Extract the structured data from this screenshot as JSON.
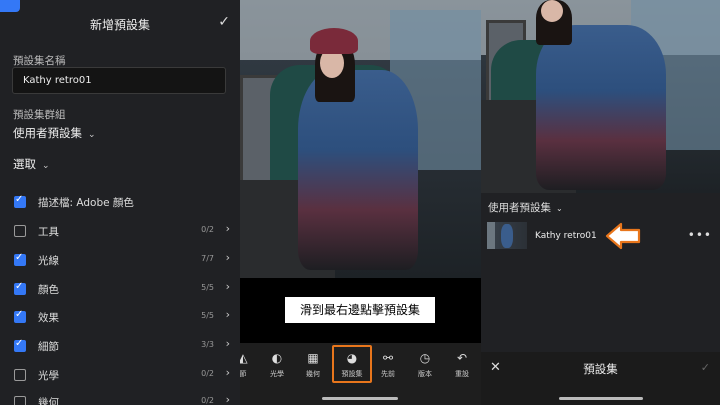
{
  "left": {
    "title": "新增預設集",
    "confirm_icon": "✓",
    "name_label": "預設集名稱",
    "name_value": "Kathy retro01",
    "group_label": "預設集群組",
    "group_value": "使用者預設集",
    "select_label": "選取",
    "chevron": "⌄",
    "items": [
      {
        "label": "描述檔: Adobe 顏色",
        "checked": true,
        "count": "",
        "arrow": ""
      },
      {
        "label": "工具",
        "checked": false,
        "count": "0/2",
        "arrow": "›"
      },
      {
        "label": "光線",
        "checked": true,
        "count": "7/7",
        "arrow": "›"
      },
      {
        "label": "顏色",
        "checked": true,
        "count": "5/5",
        "arrow": "›"
      },
      {
        "label": "效果",
        "checked": true,
        "count": "5/5",
        "arrow": "›"
      },
      {
        "label": "細節",
        "checked": true,
        "count": "3/3",
        "arrow": "›"
      },
      {
        "label": "光學",
        "checked": false,
        "count": "0/2",
        "arrow": "›"
      },
      {
        "label": "幾何",
        "checked": false,
        "count": "0/2",
        "arrow": "›"
      }
    ]
  },
  "middle": {
    "caption": "滑到最右邊點擊預設集",
    "tools": [
      {
        "label": "節",
        "icon": "◭"
      },
      {
        "label": "光學",
        "icon": "◐"
      },
      {
        "label": "幾何",
        "icon": "▦"
      },
      {
        "label": "預設集",
        "icon": "◕"
      },
      {
        "label": "先前",
        "icon": "⚯"
      },
      {
        "label": "版本",
        "icon": "◷"
      },
      {
        "label": "重設",
        "icon": "↶"
      }
    ]
  },
  "right": {
    "group_value": "使用者預設集",
    "chevron": "⌄",
    "preset_name": "Kathy retro01",
    "more_icon": "•••",
    "panel_title": "預設集",
    "close_icon": "✕",
    "ok_icon": "✓",
    "arrow_color": "#e8761c"
  },
  "colors": {
    "accent_blue": "#3478f6",
    "highlight_orange": "#e8761c"
  }
}
